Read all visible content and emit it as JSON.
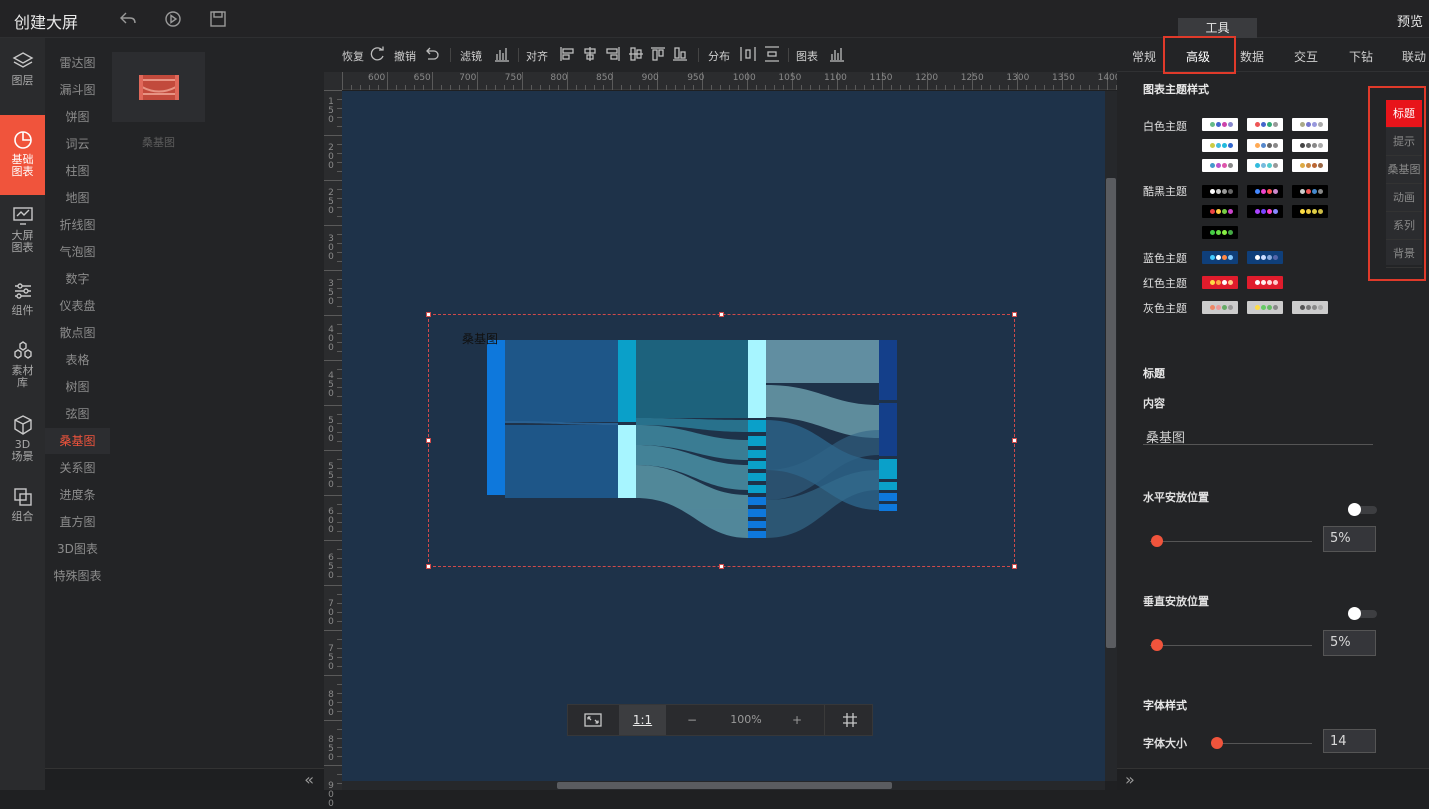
{
  "app": {
    "title": "创建大屏",
    "preview": "预览",
    "tool_tab": "工具"
  },
  "leftnav": [
    {
      "name": "layers",
      "label_l1": "图层",
      "label_l2": ""
    },
    {
      "name": "basic-chart",
      "label_l1": "基础",
      "label_l2": "图表"
    },
    {
      "name": "screen-chart",
      "label_l1": "大屏",
      "label_l2": "图表"
    },
    {
      "name": "component",
      "label_l1": "组件",
      "label_l2": ""
    },
    {
      "name": "material",
      "label_l1": "素材",
      "label_l2": "库"
    },
    {
      "name": "3d-scene",
      "label_l1": "3D",
      "label_l2": "场景"
    },
    {
      "name": "combine",
      "label_l1": "组合",
      "label_l2": ""
    }
  ],
  "categories": [
    "雷达图",
    "漏斗图",
    "饼图",
    "词云",
    "柱图",
    "地图",
    "折线图",
    "气泡图",
    "数字",
    "仪表盘",
    "散点图",
    "表格",
    "树图",
    "弦图",
    "桑基图",
    "关系图",
    "进度条",
    "直方图",
    "3D图表",
    "特殊图表"
  ],
  "active_category": "桑基图",
  "thumb_label": "桑基图",
  "toolbar": {
    "redo": "恢复",
    "undo": "撤销",
    "filter": "滤镜",
    "align": "对齐",
    "distribute": "分布",
    "chart": "图表"
  },
  "ruler_top": [
    "600",
    "650",
    "700",
    "750",
    "800",
    "850",
    "900",
    "950",
    "1000",
    "1050",
    "1100",
    "1150",
    "1200",
    "1250",
    "1300",
    "1350",
    "1400"
  ],
  "ruler_left": [
    "150",
    "200",
    "250",
    "300",
    "350",
    "400",
    "450",
    "500",
    "550",
    "600",
    "650",
    "700",
    "750",
    "800",
    "850",
    "900"
  ],
  "chart": {
    "title": "桑基图"
  },
  "zoom": {
    "ratio": "1:1",
    "minus": "−",
    "level": "100%",
    "plus": "+"
  },
  "right_tabs": [
    "常规",
    "高级",
    "数据",
    "交互",
    "下钻",
    "联动"
  ],
  "right_active_tab": "高级",
  "theme": {
    "section_title": "图表主题样式",
    "white": "白色主题",
    "dark": "酷黑主题",
    "blue": "蓝色主题",
    "red": "红色主题",
    "gray": "灰色主题"
  },
  "side_tabs": [
    "标题",
    "提示",
    "桑基图",
    "动画",
    "系列",
    "背景"
  ],
  "side_active": "标题",
  "title_section": {
    "heading": "标题",
    "content_label": "内容",
    "content_value": "桑基图",
    "h_pos_label": "水平安放位置",
    "h_pos_value": "5%",
    "v_pos_label": "垂直安放位置",
    "v_pos_value": "5%",
    "font_style": "字体样式",
    "font_size_label": "字体大小",
    "font_size_value": "14"
  },
  "colors": {
    "accent": "#f0543c",
    "highlight": "#e03a2a",
    "canvas": "#1e3249"
  }
}
